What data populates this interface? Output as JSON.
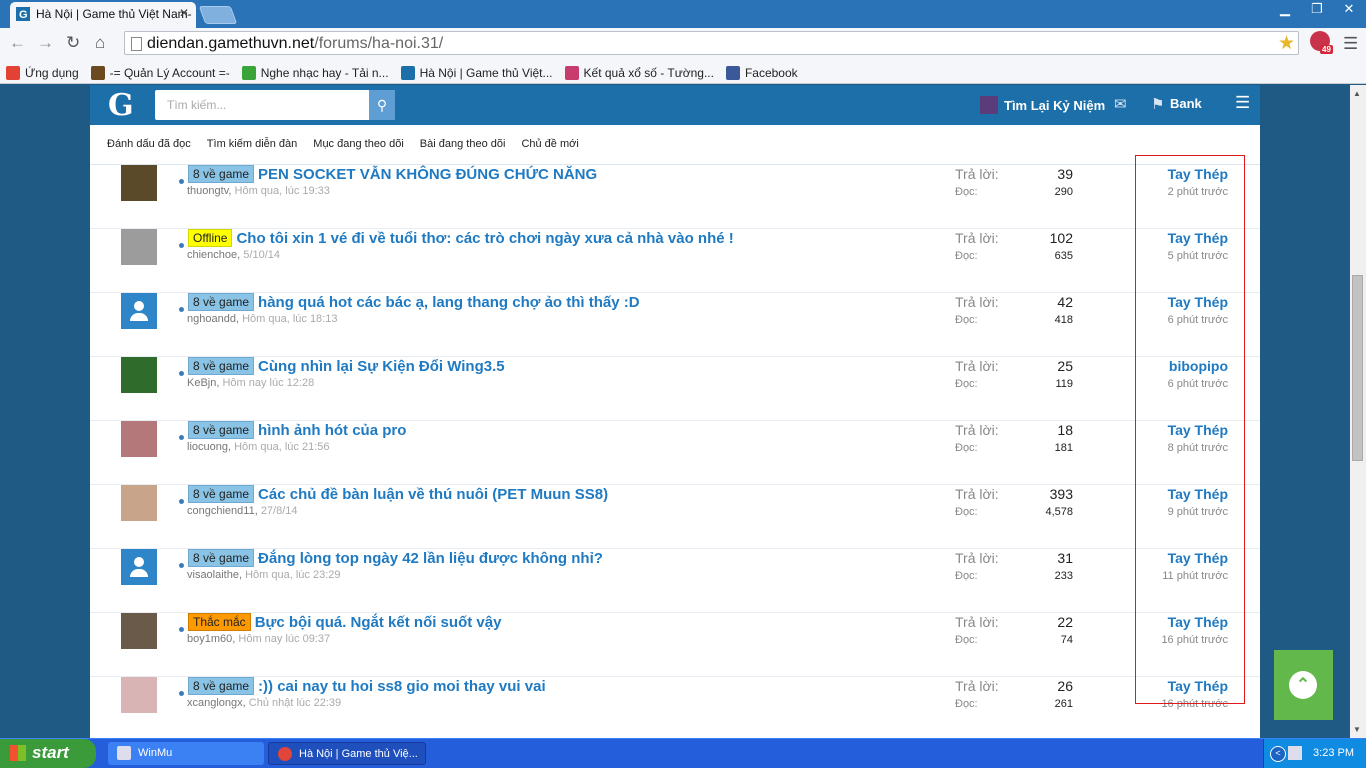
{
  "browser": {
    "tab_title": "Hà Nội | Game thủ Việt Nam-",
    "url_host": "diendan.gamethuvn.net",
    "url_path": "/forums/ha-noi.31/",
    "extension_badge": "49",
    "bookmarks": [
      {
        "label": "Ứng dụng",
        "color": "#e34133"
      },
      {
        "label": "-= Quản Lý Account =-",
        "color": "#6b4a1f"
      },
      {
        "label": "Nghe nhạc hay - Tải n...",
        "color": "#3aa33a"
      },
      {
        "label": "Hà Nội | Game thủ Việt...",
        "color": "#1d6fa9"
      },
      {
        "label": "Kết quả xổ số - Tường...",
        "color": "#c83b6d"
      },
      {
        "label": "Facebook",
        "color": "#3b5998"
      }
    ]
  },
  "site": {
    "logo": "G",
    "search_placeholder": "Tìm kiếm...",
    "username": "Tìm Lại Kỷ Niệm",
    "bank_label": "Bank",
    "subnav": [
      "Đánh dấu đã đọc",
      "Tìm kiếm diễn đàn",
      "Mục đang theo dõi",
      "Bài đang theo dõi",
      "Chủ đề mới"
    ]
  },
  "labels": {
    "replies": "Trả lời:",
    "views": "Đọc:"
  },
  "threads": [
    {
      "prefix": "8 về game",
      "prefix_type": "game",
      "title": "PEN SOCKET VẪN KHÔNG ĐÚNG CHỨC NĂNG",
      "author": "thuongtv",
      "date": "Hôm qua, lúc 19:33",
      "replies": "39",
      "views": "290",
      "last_user": "Tay Thép",
      "last_time": "2 phút trước",
      "avatar": "photo",
      "avatar_color": "#5a4a2a"
    },
    {
      "prefix": "Offline",
      "prefix_type": "offline",
      "title": "Cho tôi xin 1 vé đi về tuổi thơ: các trò chơi ngày xưa cả nhà vào nhé !",
      "author": "chienchoe",
      "date": "5/10/14",
      "replies": "102",
      "views": "635",
      "last_user": "Tay Thép",
      "last_time": "5 phút trước",
      "avatar": "photo",
      "avatar_color": "#9c9c9c"
    },
    {
      "prefix": "8 về game",
      "prefix_type": "game",
      "title": "hàng quá hot các bác ạ, lang thang chợ ảo thì thấy :D",
      "author": "nghoandd",
      "date": "Hôm qua, lúc 18:13",
      "replies": "42",
      "views": "418",
      "last_user": "Tay Thép",
      "last_time": "6 phút trước",
      "avatar": "default",
      "avatar_color": "#2e86c9"
    },
    {
      "prefix": "8 về game",
      "prefix_type": "game",
      "title": "Cùng nhìn lại Sự Kiện Đổi Wing3.5",
      "author": "KeBjn",
      "date": "Hôm nay lúc 12:28",
      "replies": "25",
      "views": "119",
      "last_user": "bibopipo",
      "last_time": "6 phút trước",
      "avatar": "photo",
      "avatar_color": "#2f6b2a"
    },
    {
      "prefix": "8 về game",
      "prefix_type": "game",
      "title": "hình ảnh hót của pro",
      "author": "liocuong",
      "date": "Hôm qua, lúc 21:56",
      "replies": "18",
      "views": "181",
      "last_user": "Tay Thép",
      "last_time": "8 phút trước",
      "avatar": "photo",
      "avatar_color": "#b5787a"
    },
    {
      "prefix": "8 về game",
      "prefix_type": "game",
      "title": "Các chủ đề bàn luận về thú nuôi (PET Muun SS8)",
      "author": "congchiend11",
      "date": "27/8/14",
      "replies": "393",
      "views": "4,578",
      "last_user": "Tay Thép",
      "last_time": "9 phút trước",
      "avatar": "photo",
      "avatar_color": "#c8a58a"
    },
    {
      "prefix": "8 về game",
      "prefix_type": "game",
      "title": "Đắng lòng top ngày 42 lần liệu được không nhỉ?",
      "author": "visaolaithe",
      "date": "Hôm qua, lúc 23:29",
      "replies": "31",
      "views": "233",
      "last_user": "Tay Thép",
      "last_time": "11 phút trước",
      "avatar": "default",
      "avatar_color": "#2e86c9"
    },
    {
      "prefix": "Thắc mắc",
      "prefix_type": "thac",
      "title": "Bực bội quá. Ngắt kết nối suốt vậy",
      "author": "boy1m60",
      "date": "Hôm nay lúc 09:37",
      "replies": "22",
      "views": "74",
      "last_user": "Tay Thép",
      "last_time": "16 phút trước",
      "avatar": "photo",
      "avatar_color": "#6a5a4a"
    },
    {
      "prefix": "8 về game",
      "prefix_type": "game",
      "title": ":)) cai nay tu hoi ss8 gio moi thay vui vai",
      "author": "xcanglongx",
      "date": "Chủ nhật lúc 22:39",
      "replies": "26",
      "views": "261",
      "last_user": "Tay Thép",
      "last_time": "16 phút trước",
      "avatar": "photo",
      "avatar_color": "#d8b4b4"
    }
  ],
  "taskbar": {
    "start": "start",
    "tasks": [
      "WinMu",
      "Hà Nội | Game thủ Việ..."
    ],
    "clock": "3:23 PM"
  }
}
